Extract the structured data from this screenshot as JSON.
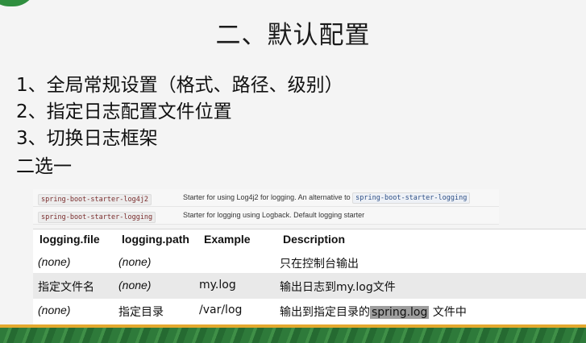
{
  "slide": {
    "title": "二、默认配置",
    "points": [
      "1、全局常规设置（格式、路径、级别）",
      "2、指定日志配置文件位置",
      "3、切换日志框架"
    ],
    "note": "二选一"
  },
  "starters": [
    {
      "name": "spring-boot-starter-log4j2",
      "description": "Starter for using Log4j2 for logging. An alternative to",
      "ref": "spring-boot-starter-logging"
    },
    {
      "name": "spring-boot-starter-logging",
      "description": "Starter for logging using Logback. Default logging starter"
    }
  ],
  "config_table": {
    "headers": [
      "logging.file",
      "logging.path",
      "Example",
      "Description"
    ],
    "rows": [
      [
        "(none)",
        "(none)",
        "",
        "只在控制台输出"
      ],
      [
        "指定文件名",
        "(none)",
        "my.log",
        "输出日志到my.log文件"
      ],
      [
        "(none)",
        "指定目录",
        "/var/log",
        "输出到指定目录的",
        "spring.log",
        " 文件中"
      ]
    ]
  },
  "colors": {
    "brand_green": "#2f8e3f",
    "stripe_orange": "#e4a92e",
    "highlight": "#9e9e9e"
  }
}
